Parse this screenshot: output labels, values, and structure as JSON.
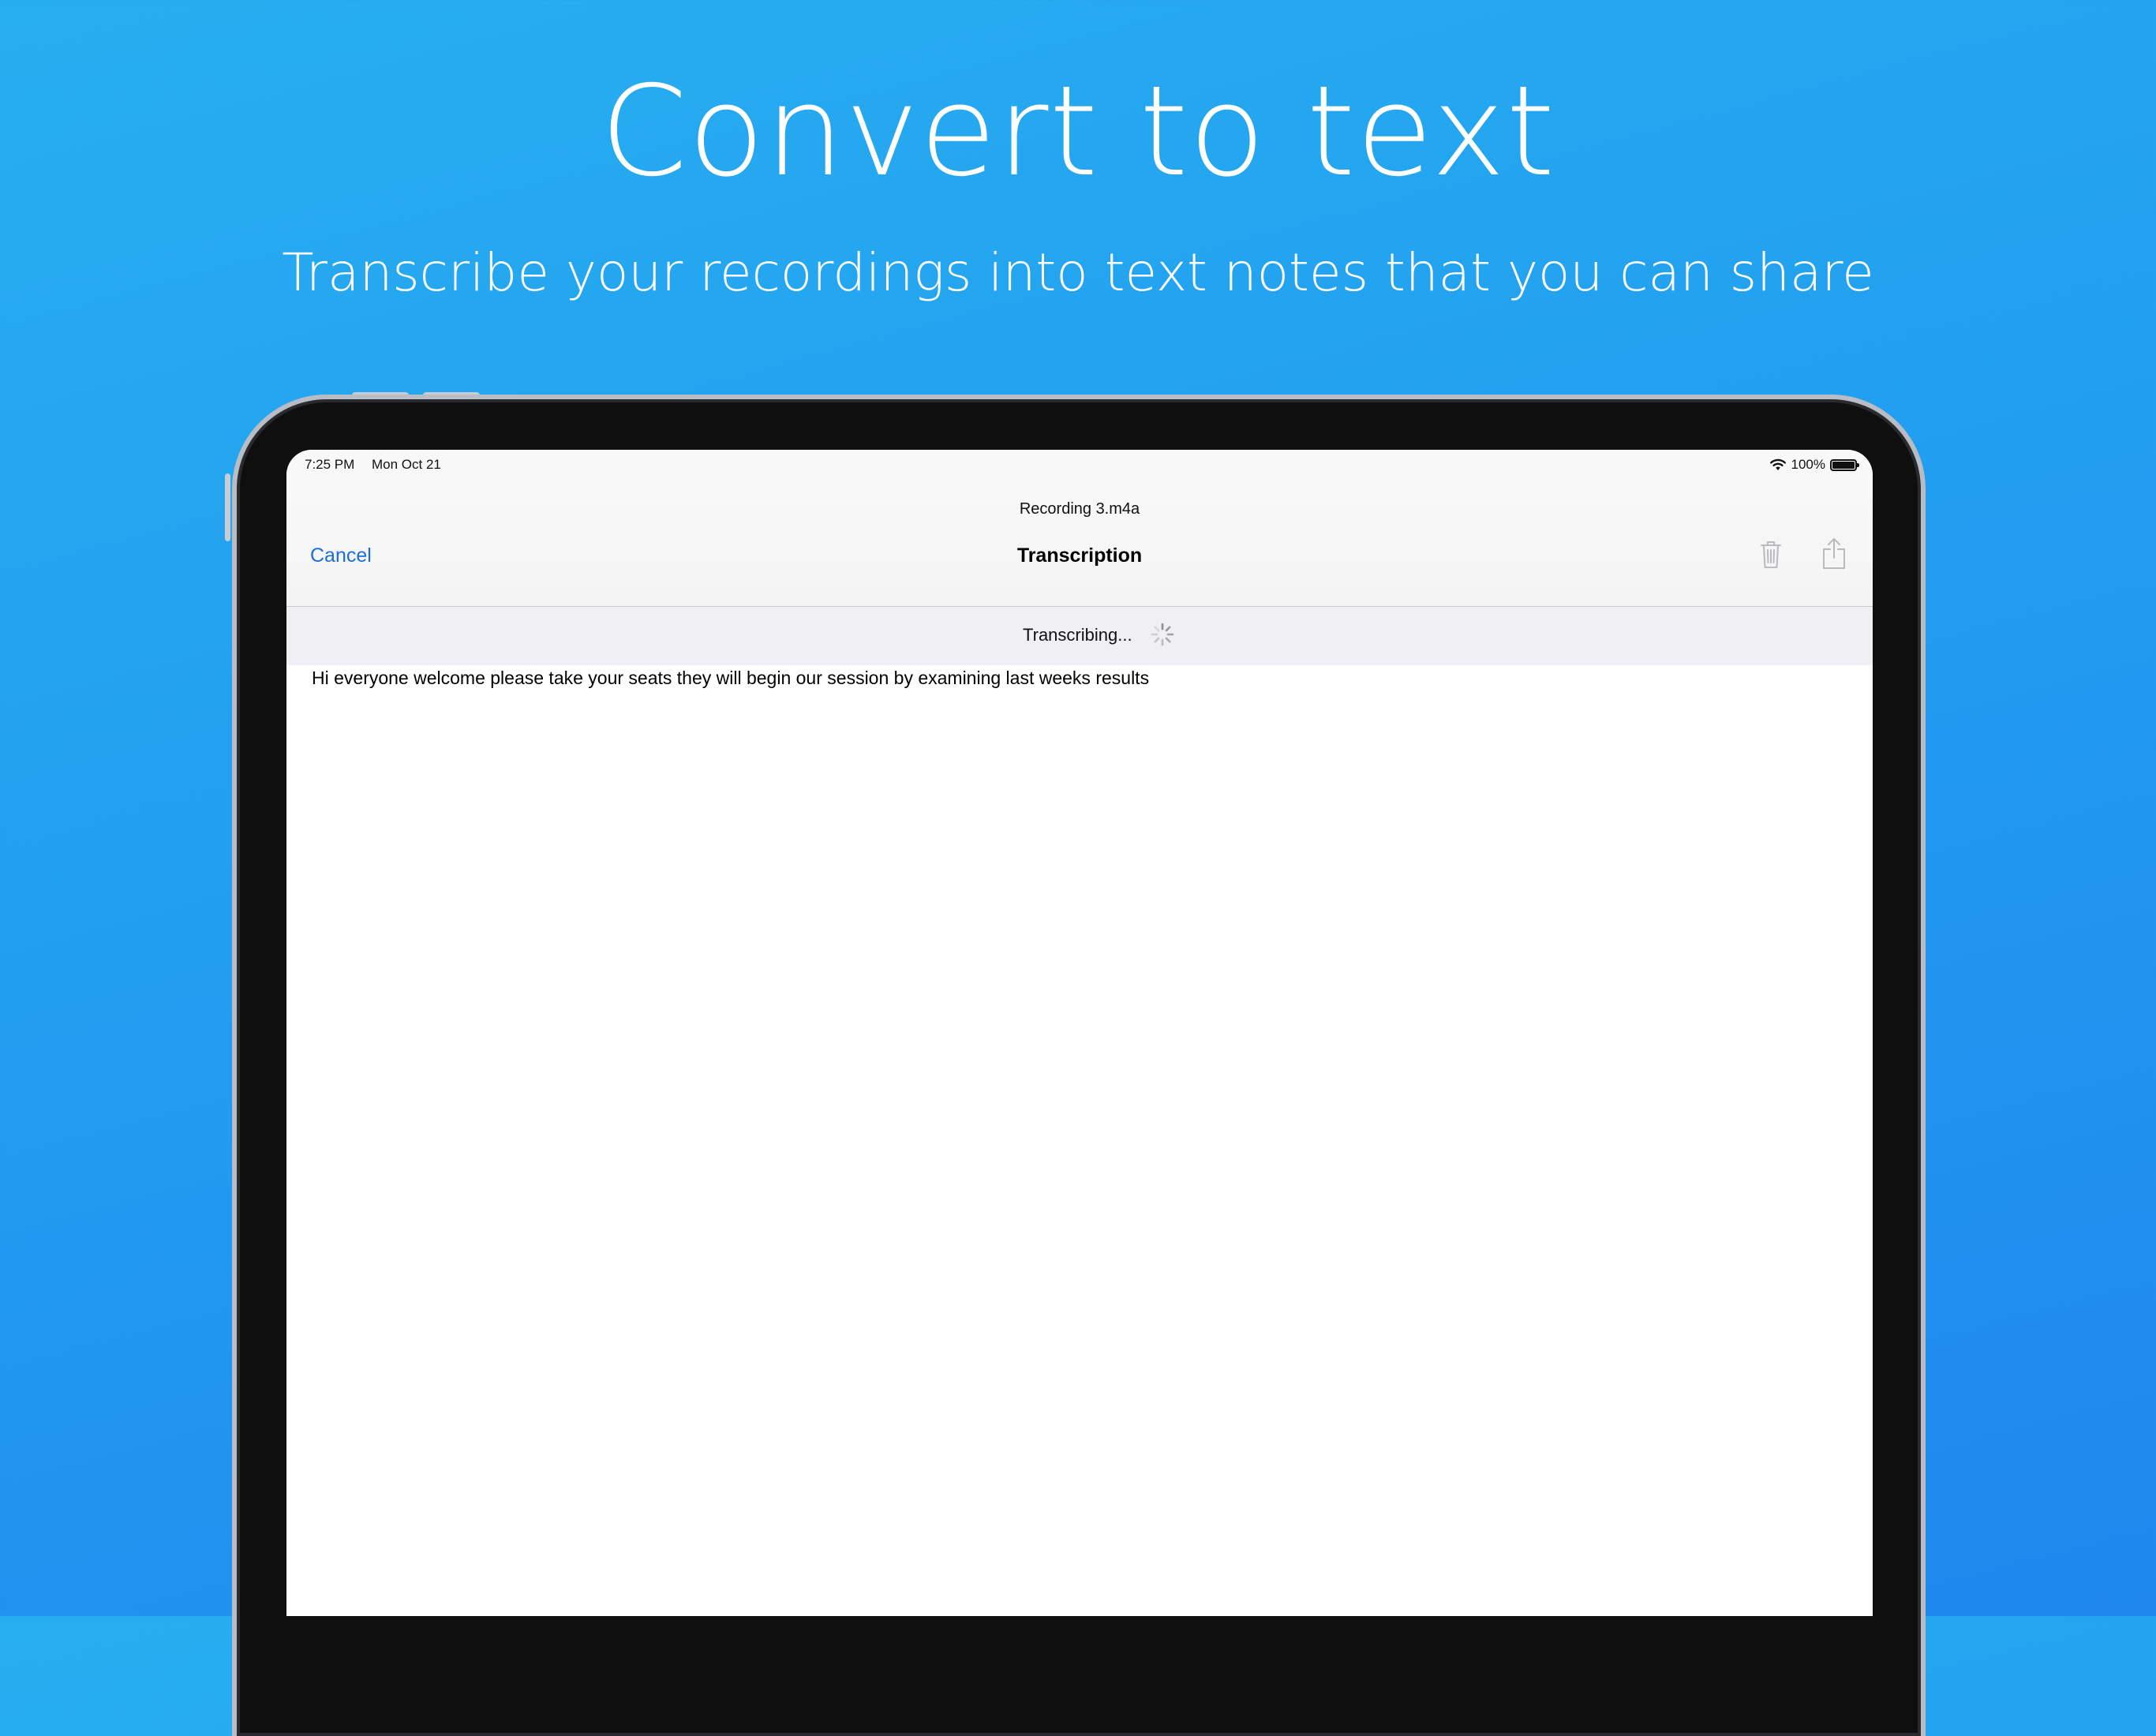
{
  "marketing": {
    "headline": "Convert to text",
    "subheadline": "Transcribe your recordings into text notes that you can share"
  },
  "status_bar": {
    "time": "7:25 PM",
    "date": "Mon Oct 21",
    "battery": "100%",
    "icons": [
      "wifi-icon",
      "battery-icon"
    ]
  },
  "nav": {
    "subtitle": "Recording 3.m4a",
    "title": "Transcription",
    "cancel_label": "Cancel",
    "actions": [
      "trash-icon",
      "share-icon"
    ]
  },
  "progress": {
    "label": "Transcribing...",
    "icon": "activity-spinner-icon"
  },
  "transcript": {
    "text": "Hi everyone welcome please take your seats they will begin our session by examining last weeks results"
  },
  "colors": {
    "background_top": "#27aef0",
    "background_bottom": "#1f87ee",
    "accent": "#1a6fd8",
    "progress_strip": "#efeff4"
  }
}
